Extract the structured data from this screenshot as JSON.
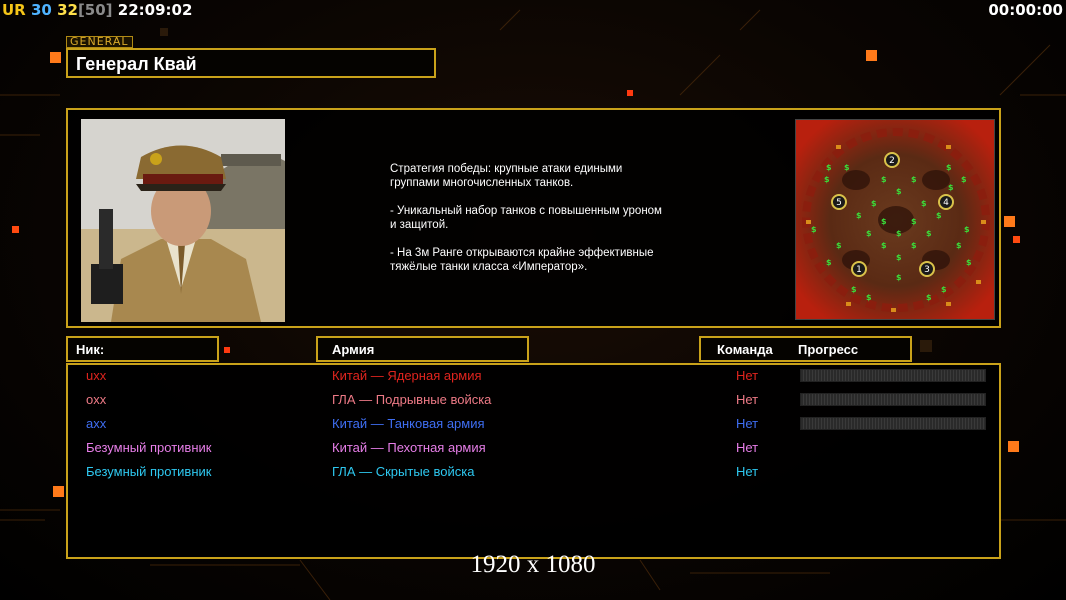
{
  "hud": {
    "ur": "UR",
    "val1": "30",
    "val2": "32",
    "val3": "[50]",
    "clock": "22:09:02",
    "timer": "00:00:00"
  },
  "general": {
    "tag": "GENERAL",
    "name": "Генерал Квай",
    "description": [
      "Стратегия победы: крупные атаки едиными\n группами многочисленных танков.",
      "- Уникальный набор танков с повышенным уроном\n и защитой.",
      "- На 3м Ранге открываются крайне эффективные\n тяжёлые танки класса «Император»."
    ],
    "portrait_icon": "general-portrait",
    "map_icon": "minimap",
    "map_spawns": [
      "1",
      "2",
      "3",
      "4",
      "5"
    ]
  },
  "columns": {
    "nick": "Ник:",
    "army": "Армия",
    "team": "Команда",
    "progress": "Прогресс"
  },
  "players": [
    {
      "nick": "uxx",
      "army": "Китай — Ядерная армия",
      "team": "Нет",
      "color": "#e0241e",
      "has_progress": true
    },
    {
      "nick": "oxx",
      "army": "ГЛА — Подрывные войска",
      "team": "Нет",
      "color": "#ee7a86",
      "has_progress": true
    },
    {
      "nick": "axx",
      "army": "Китай — Танковая армия",
      "team": "Нет",
      "color": "#3f6ef2",
      "has_progress": true
    },
    {
      "nick": "Безумный противник",
      "army": "Китай — Пехотная армия",
      "team": "Нет",
      "color": "#e77ee8",
      "has_progress": false
    },
    {
      "nick": "Безумный противник",
      "army": "ГЛА — Скрытые войска",
      "team": "Нет",
      "color": "#2ec8f0",
      "has_progress": false
    }
  ],
  "colors": {
    "accent_gold": "#c9a21a",
    "background": "#000000"
  },
  "resolution": "1920 x 1080"
}
